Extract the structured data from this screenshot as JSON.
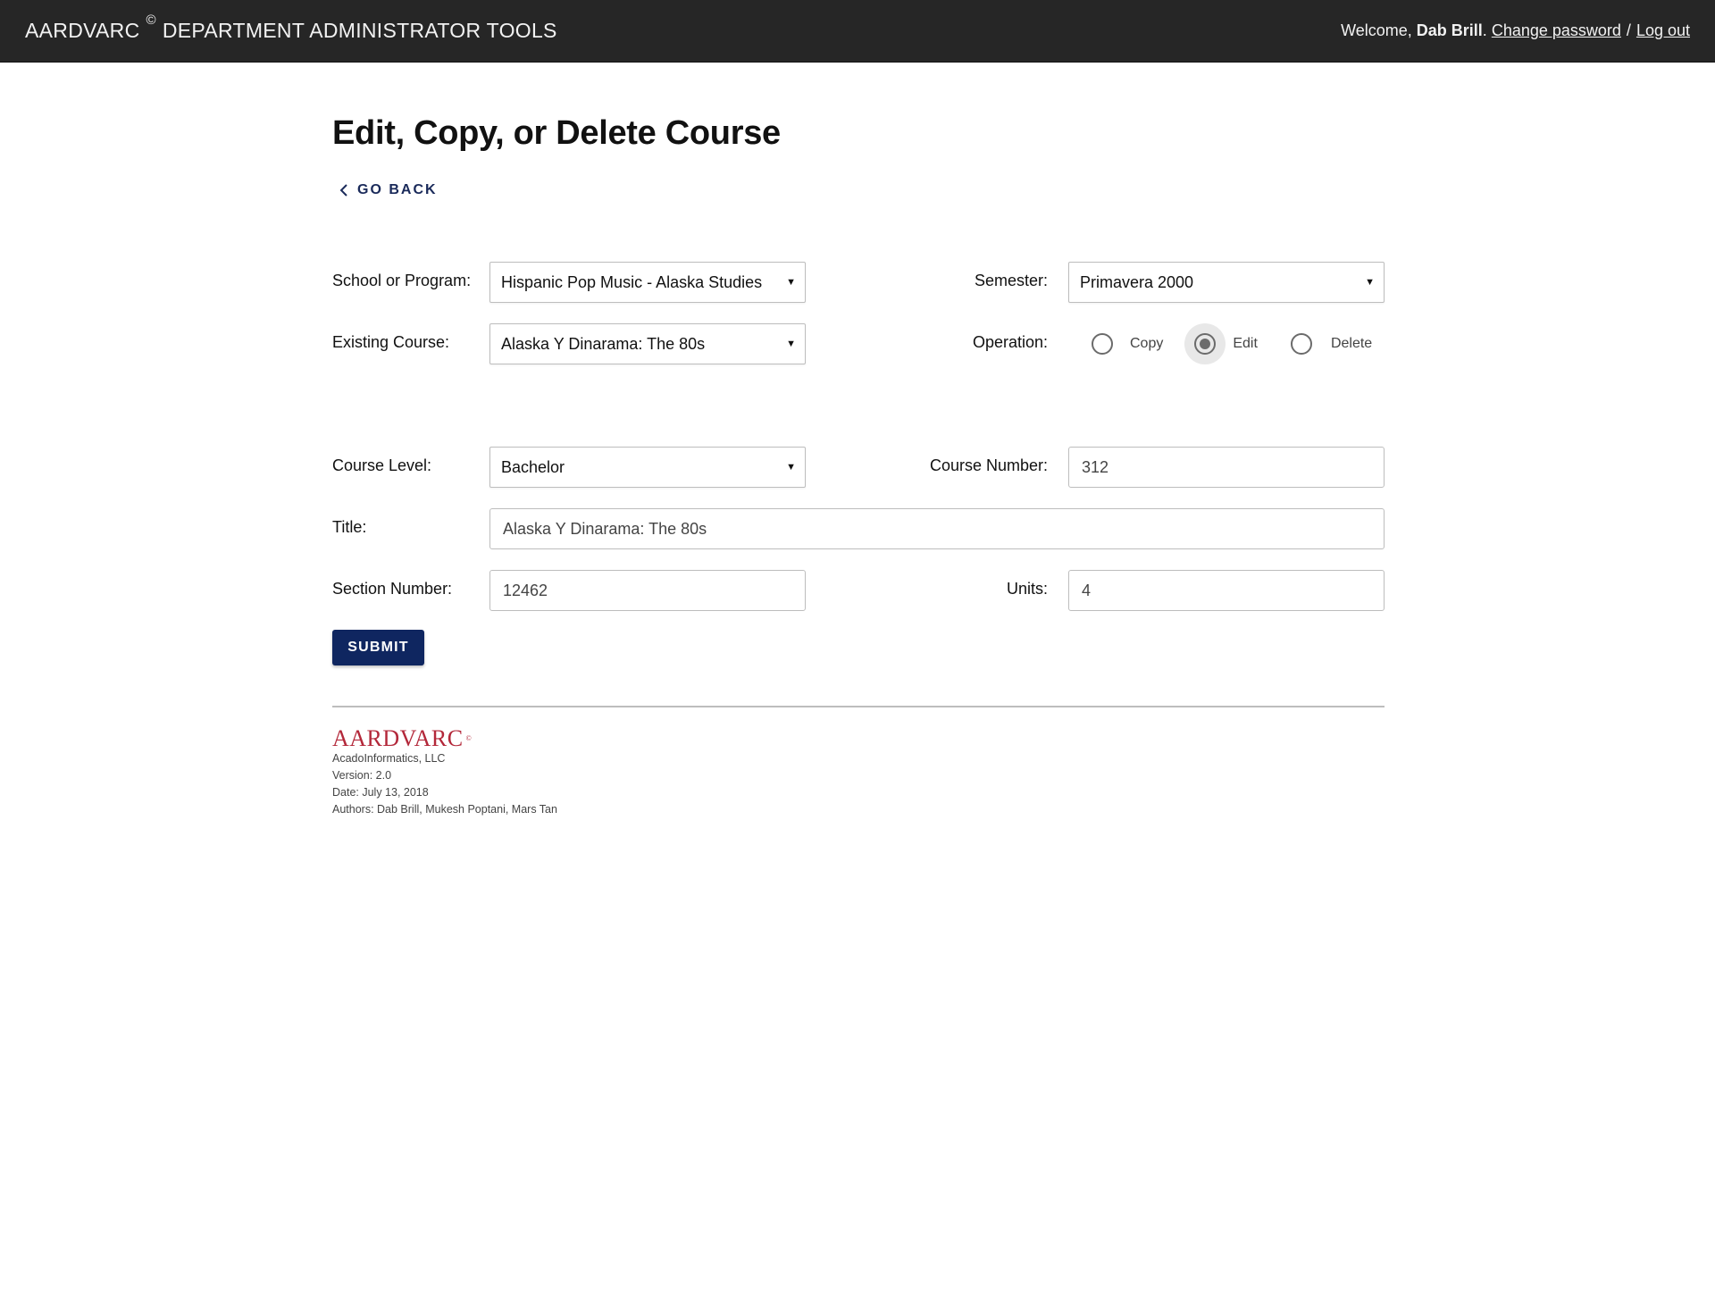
{
  "header": {
    "app_name": "AARDVARC",
    "copyright_mark": "©",
    "app_subtitle": "DEPARTMENT ADMINISTRATOR TOOLS",
    "welcome_text": "Welcome,",
    "user_name": "Dab Brill",
    "user_suffix": ".",
    "change_password_label": "Change password",
    "separator": "/",
    "logout_label": "Log out"
  },
  "page": {
    "title": "Edit, Copy, or Delete Course",
    "back_label": "GO BACK",
    "back_icon": "chevron-left-icon"
  },
  "form": {
    "school_label": "School or Program:",
    "school_value": "Hispanic Pop Music - Alaska Studies",
    "semester_label": "Semester:",
    "semester_value": "Primavera 2000",
    "existing_course_label": "Existing Course:",
    "existing_course_value": "Alaska Y Dinarama: The 80s",
    "operation_label": "Operation:",
    "operations": [
      {
        "label": "Copy",
        "checked": false
      },
      {
        "label": "Edit",
        "checked": true
      },
      {
        "label": "Delete",
        "checked": false
      }
    ],
    "course_level_label": "Course Level:",
    "course_level_value": "Bachelor",
    "course_number_label": "Course Number:",
    "course_number_value": "312",
    "title_label": "Title:",
    "title_value": "Alaska Y Dinarama: The 80s",
    "section_number_label": "Section Number:",
    "section_number_value": "12462",
    "units_label": "Units:",
    "units_value": "4",
    "submit_label": "SUBMIT",
    "dropdown_caret": "▼"
  },
  "footer": {
    "logo_text": "AARDVARC",
    "logo_mark": "©",
    "company": "AcadoInformatics, LLC",
    "version": "Version: 2.0",
    "date": "Date: July 13, 2018",
    "authors": "Authors: Dab Brill, Mukesh Poptani, Mars Tan"
  },
  "colors": {
    "topbar_bg": "#262626",
    "accent_navy": "#0f2660",
    "logo_red": "#b3283a"
  }
}
